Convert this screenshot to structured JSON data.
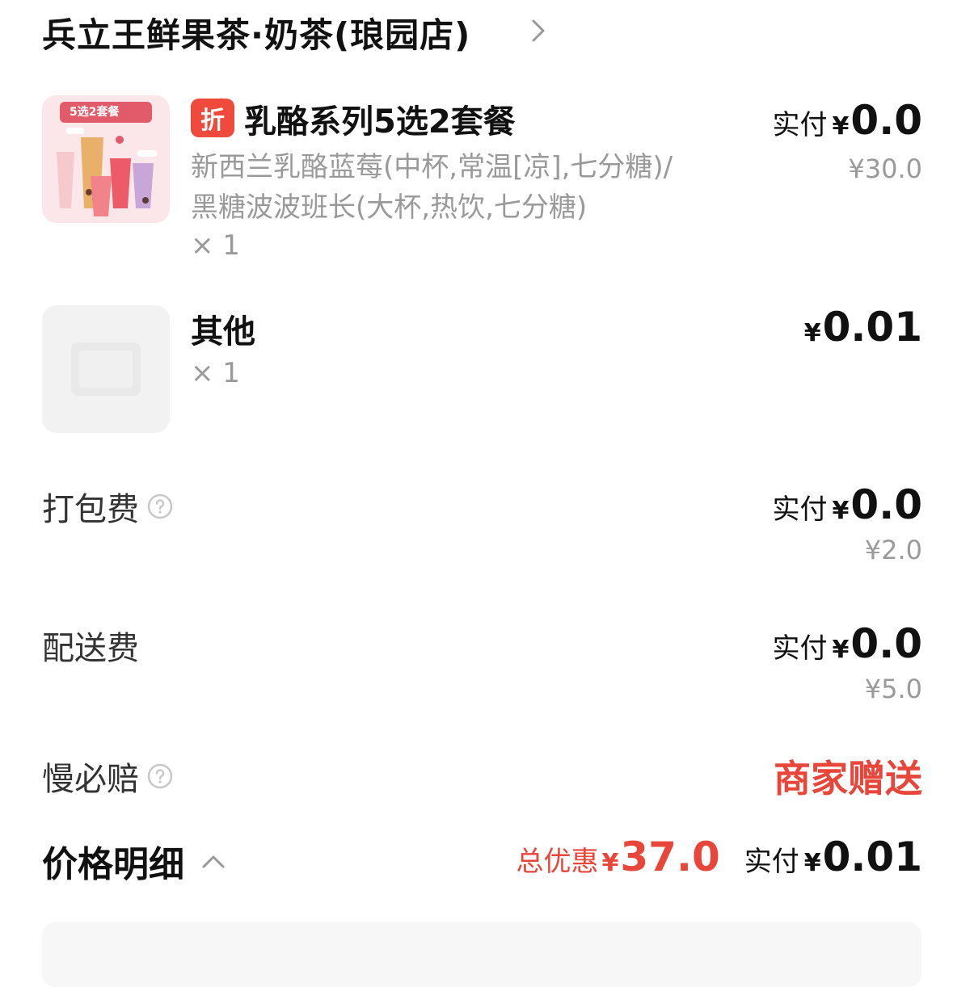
{
  "store": {
    "name": "兵立王鲜果茶·奶茶(琅园店)"
  },
  "items": [
    {
      "badge": "折",
      "name": "乳酪系列5选2套餐",
      "description": "新西兰乳酪蓝莓(中杯,常温[凉],七分糖)/黑糖波波班长(大杯,热饮,七分糖)",
      "quantity": "× 1",
      "paid_label": "实付",
      "currency": "¥",
      "paid_amount": "0.0",
      "original_price": "¥30.0",
      "thumb_text": "5选2套餐"
    },
    {
      "name": "其他",
      "quantity": "× 1",
      "currency": "¥",
      "paid_amount": "0.01"
    }
  ],
  "fees": {
    "packing": {
      "label": "打包费",
      "paid_label": "实付",
      "currency": "¥",
      "paid_amount": "0.0",
      "original_price": "¥2.0"
    },
    "delivery": {
      "label": "配送费",
      "paid_label": "实付",
      "currency": "¥",
      "paid_amount": "0.0",
      "original_price": "¥5.0"
    },
    "slow_compensation": {
      "label": "慢必赔",
      "value": "商家赠送"
    }
  },
  "price_detail": {
    "title": "价格明细",
    "total_discount_label": "总优惠",
    "currency": "¥",
    "total_discount": "37.0",
    "paid_label": "实付",
    "paid_amount": "0.01"
  },
  "colors": {
    "accent_red": "#e8463a",
    "badge_red": "#ef4a3c",
    "muted": "#9a9a9a"
  }
}
